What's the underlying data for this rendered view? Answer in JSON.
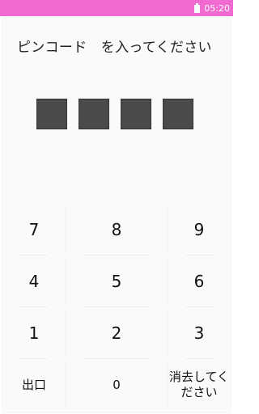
{
  "status_bar": {
    "time": "05:20",
    "battery_icon": "battery-icon",
    "color": "#f06ad0"
  },
  "prompt": "ピンコード　を入ってください",
  "pin": {
    "length": 4,
    "filled": 0
  },
  "keypad": {
    "rows": [
      [
        "7",
        "8",
        "9"
      ],
      [
        "4",
        "5",
        "6"
      ],
      [
        "1",
        "2",
        "3"
      ],
      [
        "出口",
        "0",
        "消去してください"
      ]
    ]
  }
}
